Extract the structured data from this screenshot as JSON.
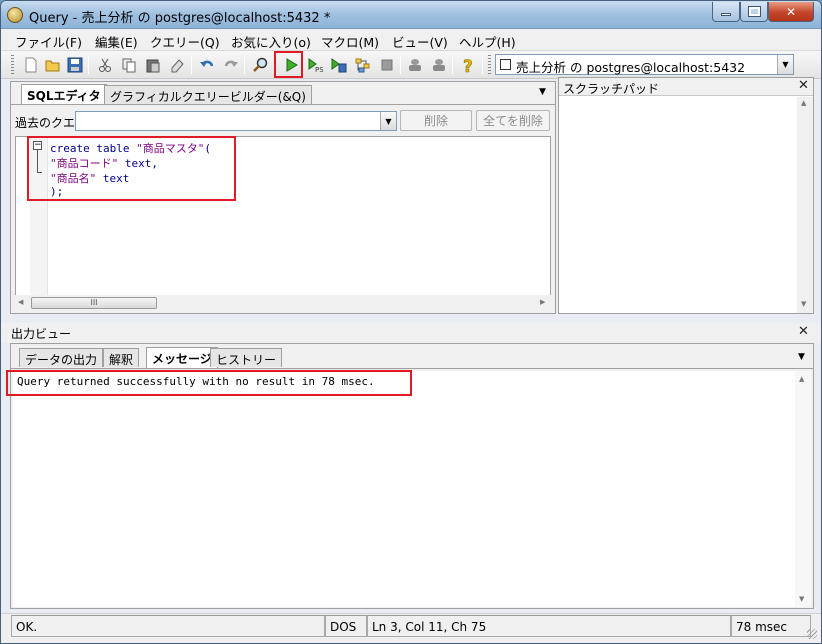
{
  "window": {
    "title": "Query - 売上分析 の postgres@localhost:5432 *"
  },
  "menu": {
    "items": [
      {
        "label": "ファイル(F)"
      },
      {
        "label": "編集(E)"
      },
      {
        "label": "クエリー(Q)"
      },
      {
        "label": "お気に入り(o)"
      },
      {
        "label": "マクロ(M)"
      },
      {
        "label": "ビュー(V)"
      },
      {
        "label": "ヘルプ(H)"
      }
    ]
  },
  "toolbar": {
    "connection": "売上分析 の postgres@localhost:5432",
    "icons": [
      "new-icon",
      "open-icon",
      "save-icon",
      "cut-icon",
      "copy-icon",
      "paste-icon",
      "clear-icon",
      "undo-icon",
      "redo-icon",
      "find-icon",
      "execute-icon",
      "execute-pgscript-icon",
      "execute-to-file-icon",
      "explain-icon",
      "cancel-icon",
      "commit-icon",
      "rollback-icon",
      "help-icon"
    ]
  },
  "editor": {
    "tabs": [
      {
        "label": "SQLエディタ"
      },
      {
        "label": "グラフィカルクエリービルダー(&Q)"
      }
    ],
    "history_label": "過去のクエリ",
    "delete_label": "削除",
    "delete_all_label": "全てを削除",
    "code_lines": [
      {
        "t1": "create table ",
        "t2": "\"商品マスタ\"",
        "t3": "("
      },
      {
        "t1": "",
        "t2": "\"商品コード\"",
        "t3": " text,"
      },
      {
        "t1": "",
        "t2": "\"商品名\"",
        "t3": " text"
      },
      {
        "t1": "",
        "t2": "",
        "t3": ");"
      }
    ],
    "scroll_grip": "III"
  },
  "scratchpad": {
    "title": "スクラッチパッド"
  },
  "output": {
    "title": "出力ビュー",
    "tabs": [
      {
        "label": "データの出力"
      },
      {
        "label": "解釈"
      },
      {
        "label": "メッセージ"
      },
      {
        "label": "ヒストリー"
      }
    ],
    "message": "Query returned successfully with no result in 78 msec."
  },
  "status": {
    "state": "OK.",
    "encoding": "DOS",
    "position": "Ln 3, Col 11, Ch 75",
    "duration": "78 msec"
  },
  "colors": {
    "highlight": "#e01b24",
    "keyword": "#00008b",
    "string": "#7f007f"
  }
}
